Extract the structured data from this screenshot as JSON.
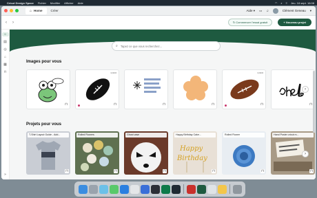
{
  "menubar": {
    "app_name": "Cricut Design Space",
    "menus": [
      "Fichier",
      "Modifier",
      "Afficher",
      "Aide"
    ],
    "clock": "Jeu. 18 sept. 16:08"
  },
  "tabs": [
    {
      "label": "Home",
      "active": true
    },
    {
      "label": "Créer",
      "active": false
    }
  ],
  "topbar": {
    "help_label": "Aide",
    "user_name": "Clément Geneau"
  },
  "toolbar": {
    "trial_button": "Commencer l'essai gratuit",
    "new_project_button": "Nouveau projet"
  },
  "search": {
    "placeholder": "Tapez ce que vous recherchez..."
  },
  "sections": {
    "images_title": "Images pour vous",
    "projects_title": "Projets pour vous"
  },
  "images": [
    {
      "icon": "frog-icon",
      "price": ""
    },
    {
      "icon": "football-icon",
      "price": "0,99 €"
    },
    {
      "icon": "winter-snowflake-icon",
      "price": ""
    },
    {
      "icon": "flower-icon",
      "price": ""
    },
    {
      "icon": "football-icon",
      "price": "0,99 €"
    },
    {
      "icon": "oh-hello-script-icon",
      "price": ""
    }
  ],
  "projects": [
    {
      "label": "T-Shirt Layout Guide - Add..."
    },
    {
      "label": "Rolled Flowers"
    },
    {
      "label": "Ghost vase"
    },
    {
      "label": "Happy Birthday Cake..."
    },
    {
      "label": "Rolled Flower"
    },
    {
      "label": "Hand Poster cricut m..."
    }
  ],
  "colors": {
    "brand_green": "#1e5a40",
    "accent_pink": "#c9356b"
  }
}
